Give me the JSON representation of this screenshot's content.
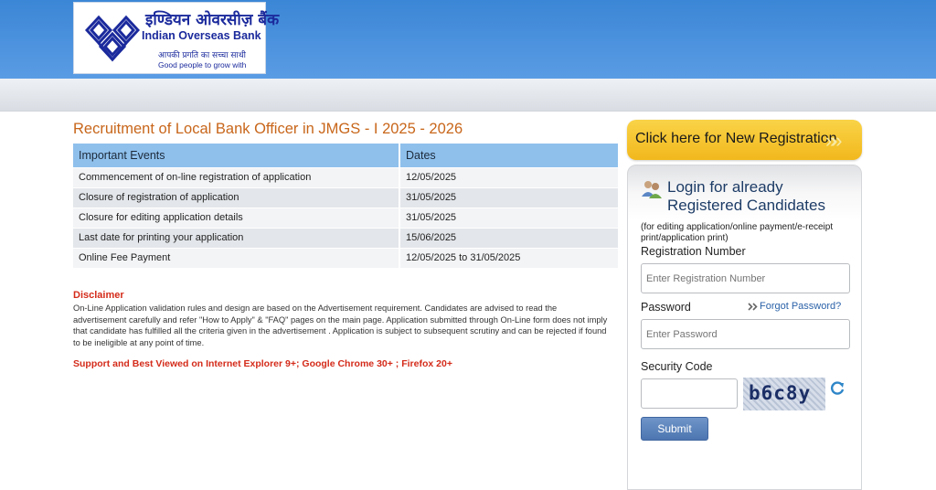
{
  "header": {
    "logo_hindi": "इण्डियन ओवरसीज़ बैंक",
    "logo_english": "Indian Overseas Bank",
    "tagline_hindi": "आपकी प्रगति का सच्चा साथी",
    "tagline_english": "Good people to grow with",
    "colors": {
      "top_bar": "#3b86d6",
      "logo_blue": "#1b2a9c"
    }
  },
  "main": {
    "title": "Recruitment of Local Bank Officer in JMGS - I 2025 - 2026",
    "table": {
      "headers": [
        "Important Events",
        "Dates"
      ],
      "rows": [
        [
          "Commencement of on-line registration of application",
          "12/05/2025"
        ],
        [
          "Closure of registration of application",
          "31/05/2025"
        ],
        [
          "Closure for editing application details",
          "31/05/2025"
        ],
        [
          "Last date for printing your application",
          "15/06/2025"
        ],
        [
          "Online Fee Payment",
          "12/05/2025 to 31/05/2025"
        ]
      ]
    },
    "disclaimer_title": "Disclaimer",
    "disclaimer_text": "On-Line Application validation rules and design are based on the Advertisement requirement. Candidates are advised to read the advertisement carefully and refer \"How to Apply\" & \"FAQ\" pages on the main page. Application submitted through On-Line form does not imply that candidate has fulfilled all the criteria given in the advertisement . Application is subject to subsequent scrutiny and can be rejected if found to be ineligible at any point of time.",
    "support_text": "Support and Best Viewed on Internet Explorer 9+; Google Chrome 30+ ; Firefox 20+"
  },
  "sidebar": {
    "new_registration_label": "Click here for New Registration",
    "login_title": "Login for already Registered Candidates",
    "login_note": "(for editing application/online payment/e-receipt print/application print)",
    "registration_label": "Registration Number",
    "registration_placeholder": "Enter Registration Number",
    "password_label": "Password",
    "forgot_password": "Forgot Password?",
    "password_placeholder": "Enter Password",
    "security_label": "Security Code",
    "captcha_text": "b6c8y",
    "submit_label": "Submit",
    "colors": {
      "new_reg_button": "#f2b81d",
      "submit_button": "#4d76b1",
      "link": "#2b62a8"
    }
  }
}
